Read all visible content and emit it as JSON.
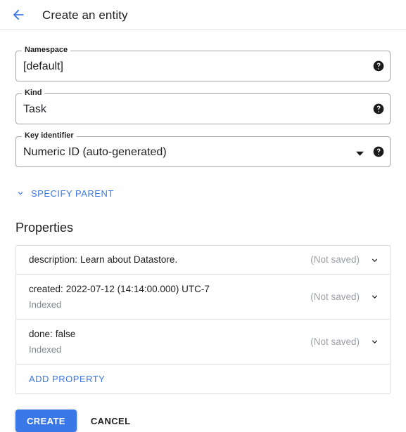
{
  "header": {
    "back_icon": "arrow-left-icon",
    "title": "Create an entity"
  },
  "form": {
    "fields": [
      {
        "label": "Namespace",
        "value": "[default]",
        "help_icon": "help-icon",
        "type": "text"
      },
      {
        "label": "Kind",
        "value": "Task",
        "help_icon": "help-icon",
        "type": "text"
      },
      {
        "label": "Key identifier",
        "value": "Numeric ID (auto-generated)",
        "help_icon": "help-icon",
        "dropdown_icon": "chevron-down-icon",
        "type": "select"
      }
    ],
    "specify_parent": {
      "label": "SPECIFY PARENT",
      "icon": "chevron-down-icon"
    }
  },
  "properties": {
    "title": "Properties",
    "rows": [
      {
        "name": "description:",
        "value": "Learn about Datastore.",
        "sub": "",
        "status": "(Not saved)",
        "expand_icon": "chevron-down-icon"
      },
      {
        "name": "created:",
        "value": "2022-07-12 (14:14:00.000) UTC-7",
        "sub": "Indexed",
        "status": "(Not saved)",
        "expand_icon": "chevron-down-icon"
      },
      {
        "name": "done:",
        "value": "false",
        "sub": "Indexed",
        "status": "(Not saved)",
        "expand_icon": "chevron-down-icon"
      }
    ],
    "add_property_label": "ADD PROPERTY"
  },
  "actions": {
    "create_label": "CREATE",
    "cancel_label": "CANCEL"
  },
  "colors": {
    "accent_blue": "#3b78e7",
    "text_primary": "#202124",
    "text_muted": "#9aa0a6",
    "border": "#e0e0e0",
    "field_border": "#a6a6a6"
  }
}
